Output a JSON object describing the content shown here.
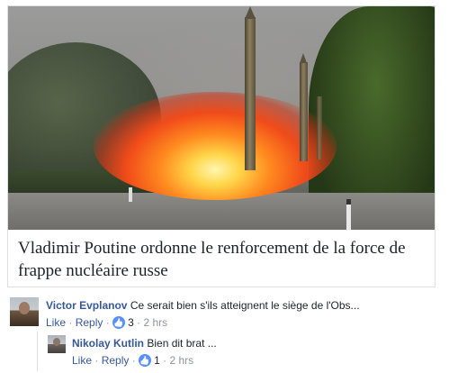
{
  "article": {
    "title": "Vladimir Poutine ordonne le renforcement de la force de frappe nucléaire russe"
  },
  "comments": [
    {
      "author": "Victor Evplanov",
      "text": "Ce serait bien s'ils atteignent le siège de l'Obs...",
      "like_label": "Like",
      "reply_label": "Reply",
      "reactions_count": "3",
      "time": "2 hrs"
    },
    {
      "author": "Nikolay Kutlin",
      "text": "Bien dit brat ...",
      "like_label": "Like",
      "reply_label": "Reply",
      "reactions_count": "1",
      "time": "2 hrs"
    }
  ],
  "icons": {
    "reaction": "like-thumb-icon"
  },
  "colors": {
    "link": "#365899",
    "text": "#1d2129",
    "muted": "#90949c",
    "like_badge": "#5890ff"
  }
}
